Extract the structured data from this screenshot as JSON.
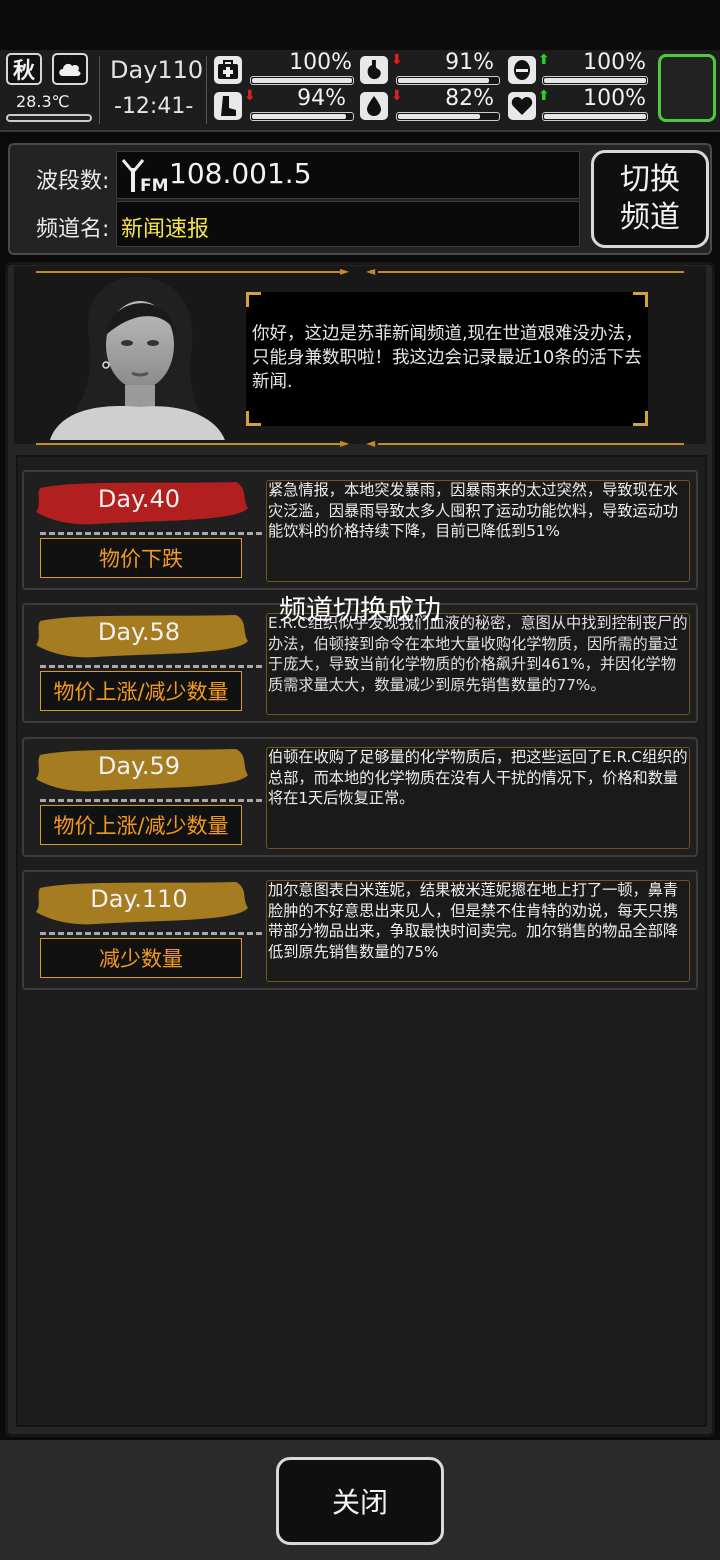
{
  "status": {
    "season": "秋",
    "weather_icon": "cloud-icon",
    "temperature": "28.3℃",
    "temperature_level": 0.18,
    "day": "Day110",
    "time": "-12:41-",
    "stats": [
      {
        "name": "health",
        "icon": "medkit-icon",
        "value": "100%",
        "level": 1.0,
        "trend": ""
      },
      {
        "name": "hunger",
        "icon": "stomach-icon",
        "value": "91%",
        "level": 0.91,
        "trend": "down"
      },
      {
        "name": "stamina",
        "icon": "mask-icon",
        "value": "100%",
        "level": 1.0,
        "trend": "up"
      },
      {
        "name": "leg",
        "icon": "boot-icon",
        "value": "94%",
        "level": 0.94,
        "trend": "down"
      },
      {
        "name": "thirst",
        "icon": "water-drop-icon",
        "value": "82%",
        "level": 0.82,
        "trend": "down"
      },
      {
        "name": "mood",
        "icon": "heart-icon",
        "value": "100%",
        "level": 1.0,
        "trend": "up"
      }
    ]
  },
  "radio": {
    "band_label": "波段数:",
    "frequency": "108.001.5",
    "channel_label": "频道名:",
    "channel_name": "新闻速报",
    "switch_label_line1": "切换",
    "switch_label_line2": "频道"
  },
  "host": {
    "speech": "你好，这边是苏菲新闻频道,现在世道艰难没办法，只能身兼数职啦！我这边会记录最近10条的活下去新闻."
  },
  "news": [
    {
      "day": "Day.40",
      "tag": "物价下跌",
      "banner_color": "#b21f1f",
      "text": "紧急情报，本地突发暴雨，因暴雨来的太过突然，导致现在水灾泛滥，因暴雨导致太多人囤积了运动功能饮料，导致运动功能饮料的价格持续下降，目前已降低到51%"
    },
    {
      "day": "Day.58",
      "tag": "物价上涨/减少数量",
      "banner_color": "#a57c1f",
      "text": "E.R.C组织似乎发现我们血液的秘密，意图从中找到控制丧尸的办法，伯顿接到命令在本地大量收购化学物质，因所需的量过于庞大，导致当前化学物质的价格飙升到461%，并因化学物质需求量太大，数量减少到原先销售数量的77%。"
    },
    {
      "day": "Day.59",
      "tag": "物价上涨/减少数量",
      "banner_color": "#a57c1f",
      "text": "伯顿在收购了足够量的化学物质后，把这些运回了E.R.C组织的总部，而本地的化学物质在没有人干扰的情况下，价格和数量将在1天后恢复正常。"
    },
    {
      "day": "Day.110",
      "tag": "减少数量",
      "banner_color": "#a57c1f",
      "text": "加尔意图表白米莲妮，结果被米莲妮摁在地上打了一顿，鼻青脸肿的不好意思出来见人，但是禁不住肯特的劝说，每天只携带部分物品出来，争取最快时间卖完。加尔销售的物品全部降低到原先销售数量的75%"
    }
  ],
  "toast": "频道切换成功",
  "close_label": "关闭"
}
